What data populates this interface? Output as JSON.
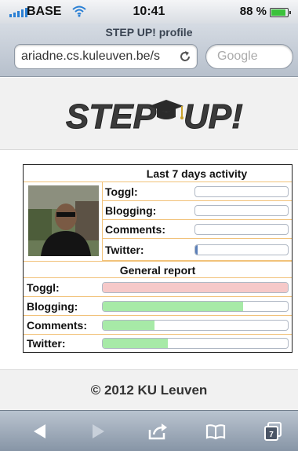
{
  "status_bar": {
    "carrier": "BASE",
    "time": "10:41",
    "battery": "88 %",
    "battery_level": 0.88
  },
  "browser": {
    "page_title": "STEP UP! profile",
    "url": "ariadne.cs.kuleuven.be/s",
    "search_placeholder": "Google",
    "tab_count": "7"
  },
  "logo": {
    "left": "STEP",
    "right": "UP!"
  },
  "activity": {
    "title": "Last 7 days activity",
    "rows": [
      {
        "label": "Toggl:",
        "value": 0
      },
      {
        "label": "Blogging:",
        "value": 0
      },
      {
        "label": "Comments:",
        "value": 0
      },
      {
        "label": "Twitter:",
        "value": 0.01
      }
    ],
    "general_title": "General report",
    "general": [
      {
        "label": "Toggl:",
        "value": 1.0,
        "color": "#f6c9c9"
      },
      {
        "label": "Blogging:",
        "value": 0.76,
        "color": "#a7eaa7"
      },
      {
        "label": "Comments:",
        "value": 0.28,
        "color": "#a7eaa7"
      },
      {
        "label": "Twitter:",
        "value": 0.35,
        "color": "#a7eaa7"
      }
    ]
  },
  "footer": {
    "copyright": "© 2012 KU Leuven"
  }
}
